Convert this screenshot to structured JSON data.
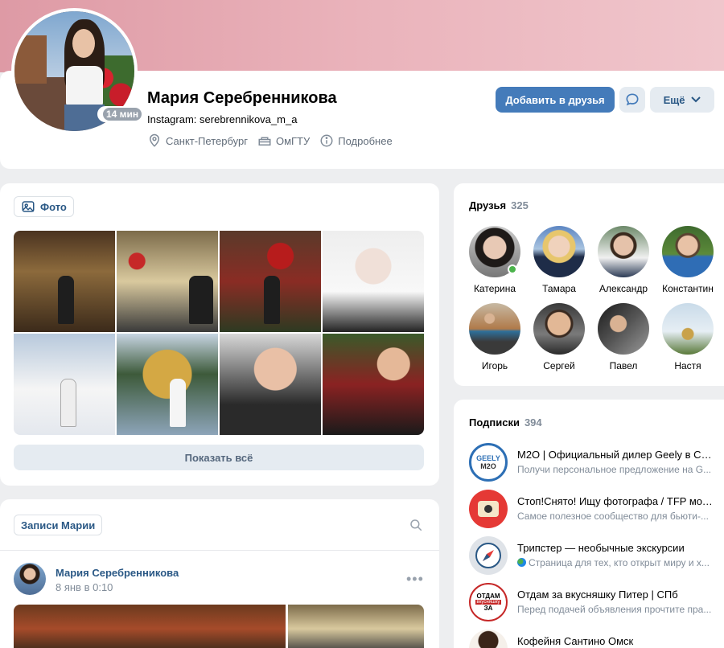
{
  "profile": {
    "name": "Мария Серебренникова",
    "status": "Instagram: serebrennikova_m_a",
    "online_ago": "14 мин",
    "city": "Санкт-Петербург",
    "university": "ОмГТУ",
    "details": "Подробнее",
    "add_friend_label": "Добавить в друзья",
    "more_label": "Ещё"
  },
  "photos": {
    "tab_label": "Фото",
    "show_all_label": "Показать всё"
  },
  "posts": {
    "tab_label": "Записи Марии",
    "author": "Мария Серебренникова",
    "date": "8 янв в 0:10"
  },
  "friends": {
    "title": "Друзья",
    "count": "325",
    "items": [
      {
        "name": "Катерина",
        "online": true
      },
      {
        "name": "Тамара"
      },
      {
        "name": "Александр"
      },
      {
        "name": "Константин"
      },
      {
        "name": "Игорь"
      },
      {
        "name": "Сергей"
      },
      {
        "name": "Павел"
      },
      {
        "name": "Настя"
      }
    ]
  },
  "subscriptions": {
    "title": "Подписки",
    "count": "394",
    "items": [
      {
        "title": "M2O | Официальный дилер Geely в Са...",
        "desc": "Получи персональное предложение на G...",
        "logo_text": "GEELY",
        "logo_sub": "M2O"
      },
      {
        "title": "Стоп!Снято! Ищу фотографа / TFP мод...",
        "desc": "Самое полезное сообщество для бьюти-..."
      },
      {
        "title": "Трипстер — необычные экскурсии",
        "desc": "Страница для тех, кто открыт миру и х..."
      },
      {
        "title": "Отдам за вкусняшку Питер | СПб",
        "desc": "Перед подачей объявления прочтите пра...",
        "logo_text": "ОТДАМ",
        "logo_mid": "вкусняшку",
        "logo_sub": "ЗА"
      },
      {
        "title": "Кофейня Сантино Омск",
        "desc": ""
      }
    ]
  },
  "colors": {
    "accent": "#447bba",
    "link": "#2a5885",
    "online": "#4bb34b"
  }
}
